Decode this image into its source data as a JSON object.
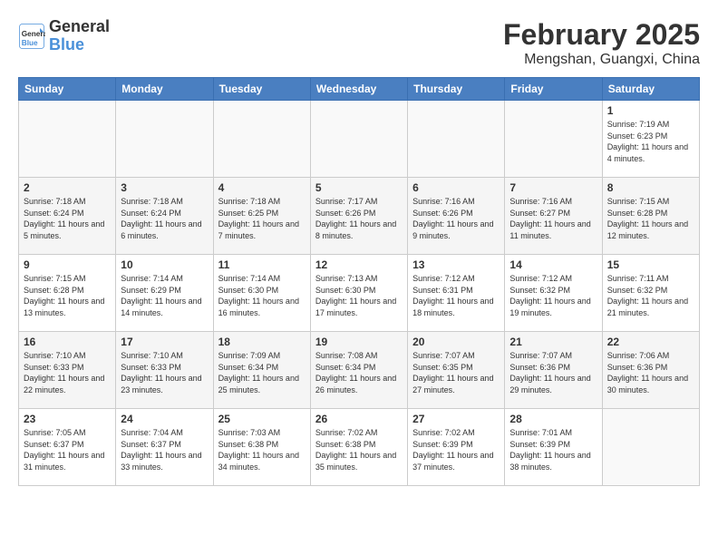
{
  "header": {
    "logo_line1": "General",
    "logo_line2": "Blue",
    "month_title": "February 2025",
    "location": "Mengshan, Guangxi, China"
  },
  "days_of_week": [
    "Sunday",
    "Monday",
    "Tuesday",
    "Wednesday",
    "Thursday",
    "Friday",
    "Saturday"
  ],
  "weeks": [
    [
      {
        "day": "",
        "info": ""
      },
      {
        "day": "",
        "info": ""
      },
      {
        "day": "",
        "info": ""
      },
      {
        "day": "",
        "info": ""
      },
      {
        "day": "",
        "info": ""
      },
      {
        "day": "",
        "info": ""
      },
      {
        "day": "1",
        "info": "Sunrise: 7:19 AM\nSunset: 6:23 PM\nDaylight: 11 hours\nand 4 minutes."
      }
    ],
    [
      {
        "day": "2",
        "info": "Sunrise: 7:18 AM\nSunset: 6:24 PM\nDaylight: 11 hours\nand 5 minutes."
      },
      {
        "day": "3",
        "info": "Sunrise: 7:18 AM\nSunset: 6:24 PM\nDaylight: 11 hours\nand 6 minutes."
      },
      {
        "day": "4",
        "info": "Sunrise: 7:18 AM\nSunset: 6:25 PM\nDaylight: 11 hours\nand 7 minutes."
      },
      {
        "day": "5",
        "info": "Sunrise: 7:17 AM\nSunset: 6:26 PM\nDaylight: 11 hours\nand 8 minutes."
      },
      {
        "day": "6",
        "info": "Sunrise: 7:16 AM\nSunset: 6:26 PM\nDaylight: 11 hours\nand 9 minutes."
      },
      {
        "day": "7",
        "info": "Sunrise: 7:16 AM\nSunset: 6:27 PM\nDaylight: 11 hours\nand 11 minutes."
      },
      {
        "day": "8",
        "info": "Sunrise: 7:15 AM\nSunset: 6:28 PM\nDaylight: 11 hours\nand 12 minutes."
      }
    ],
    [
      {
        "day": "9",
        "info": "Sunrise: 7:15 AM\nSunset: 6:28 PM\nDaylight: 11 hours\nand 13 minutes."
      },
      {
        "day": "10",
        "info": "Sunrise: 7:14 AM\nSunset: 6:29 PM\nDaylight: 11 hours\nand 14 minutes."
      },
      {
        "day": "11",
        "info": "Sunrise: 7:14 AM\nSunset: 6:30 PM\nDaylight: 11 hours\nand 16 minutes."
      },
      {
        "day": "12",
        "info": "Sunrise: 7:13 AM\nSunset: 6:30 PM\nDaylight: 11 hours\nand 17 minutes."
      },
      {
        "day": "13",
        "info": "Sunrise: 7:12 AM\nSunset: 6:31 PM\nDaylight: 11 hours\nand 18 minutes."
      },
      {
        "day": "14",
        "info": "Sunrise: 7:12 AM\nSunset: 6:32 PM\nDaylight: 11 hours\nand 19 minutes."
      },
      {
        "day": "15",
        "info": "Sunrise: 7:11 AM\nSunset: 6:32 PM\nDaylight: 11 hours\nand 21 minutes."
      }
    ],
    [
      {
        "day": "16",
        "info": "Sunrise: 7:10 AM\nSunset: 6:33 PM\nDaylight: 11 hours\nand 22 minutes."
      },
      {
        "day": "17",
        "info": "Sunrise: 7:10 AM\nSunset: 6:33 PM\nDaylight: 11 hours\nand 23 minutes."
      },
      {
        "day": "18",
        "info": "Sunrise: 7:09 AM\nSunset: 6:34 PM\nDaylight: 11 hours\nand 25 minutes."
      },
      {
        "day": "19",
        "info": "Sunrise: 7:08 AM\nSunset: 6:34 PM\nDaylight: 11 hours\nand 26 minutes."
      },
      {
        "day": "20",
        "info": "Sunrise: 7:07 AM\nSunset: 6:35 PM\nDaylight: 11 hours\nand 27 minutes."
      },
      {
        "day": "21",
        "info": "Sunrise: 7:07 AM\nSunset: 6:36 PM\nDaylight: 11 hours\nand 29 minutes."
      },
      {
        "day": "22",
        "info": "Sunrise: 7:06 AM\nSunset: 6:36 PM\nDaylight: 11 hours\nand 30 minutes."
      }
    ],
    [
      {
        "day": "23",
        "info": "Sunrise: 7:05 AM\nSunset: 6:37 PM\nDaylight: 11 hours\nand 31 minutes."
      },
      {
        "day": "24",
        "info": "Sunrise: 7:04 AM\nSunset: 6:37 PM\nDaylight: 11 hours\nand 33 minutes."
      },
      {
        "day": "25",
        "info": "Sunrise: 7:03 AM\nSunset: 6:38 PM\nDaylight: 11 hours\nand 34 minutes."
      },
      {
        "day": "26",
        "info": "Sunrise: 7:02 AM\nSunset: 6:38 PM\nDaylight: 11 hours\nand 35 minutes."
      },
      {
        "day": "27",
        "info": "Sunrise: 7:02 AM\nSunset: 6:39 PM\nDaylight: 11 hours\nand 37 minutes."
      },
      {
        "day": "28",
        "info": "Sunrise: 7:01 AM\nSunset: 6:39 PM\nDaylight: 11 hours\nand 38 minutes."
      },
      {
        "day": "",
        "info": ""
      }
    ]
  ]
}
